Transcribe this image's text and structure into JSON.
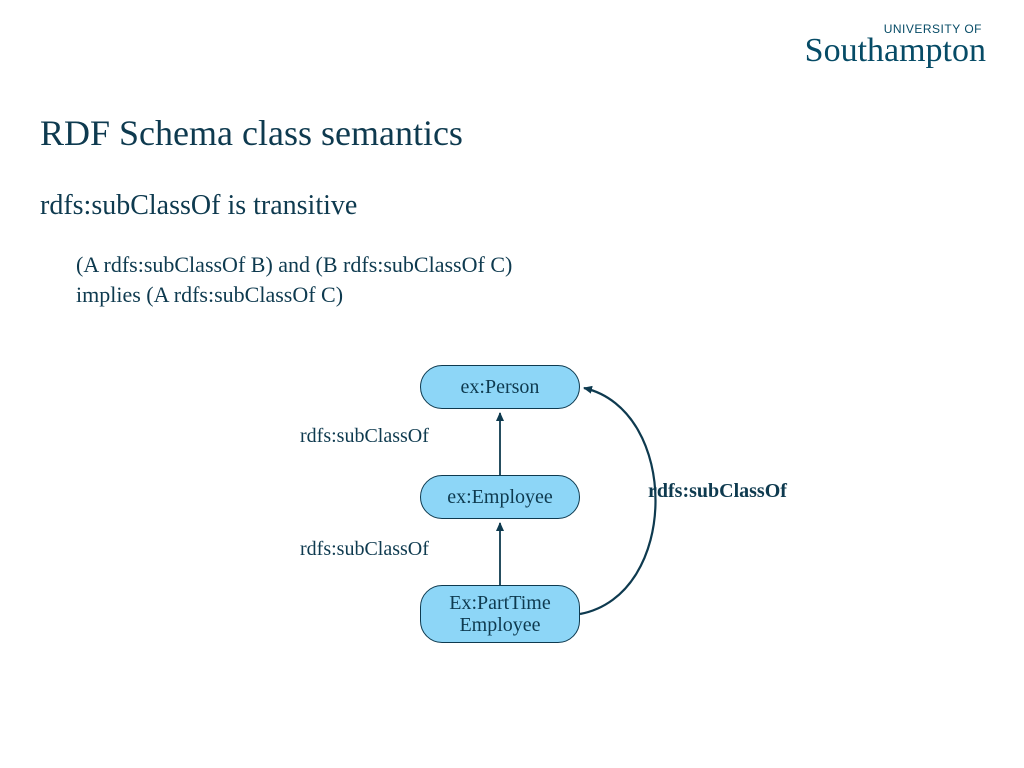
{
  "logo": {
    "line1": "UNIVERSITY OF",
    "line2": "Southampton"
  },
  "title": "RDF Schema class semantics",
  "subtitle": "rdfs:subClassOf is transitive",
  "body_line1": "(A rdfs:subClassOf B) and (B rdfs:subClassOf C)",
  "body_line2": "implies (A rdfs:subClassOf C)",
  "diagram": {
    "nodes": {
      "person": "ex:Person",
      "employee": "ex:Employee",
      "parttime": "Ex:PartTime\nEmployee"
    },
    "edge_labels": {
      "top": "rdfs:subClassOf",
      "bottom": "rdfs:subClassOf",
      "curve": "rdfs:subClassOf"
    }
  },
  "colors": {
    "primary": "#0e3a4f",
    "node_fill": "#8dd6f7"
  }
}
